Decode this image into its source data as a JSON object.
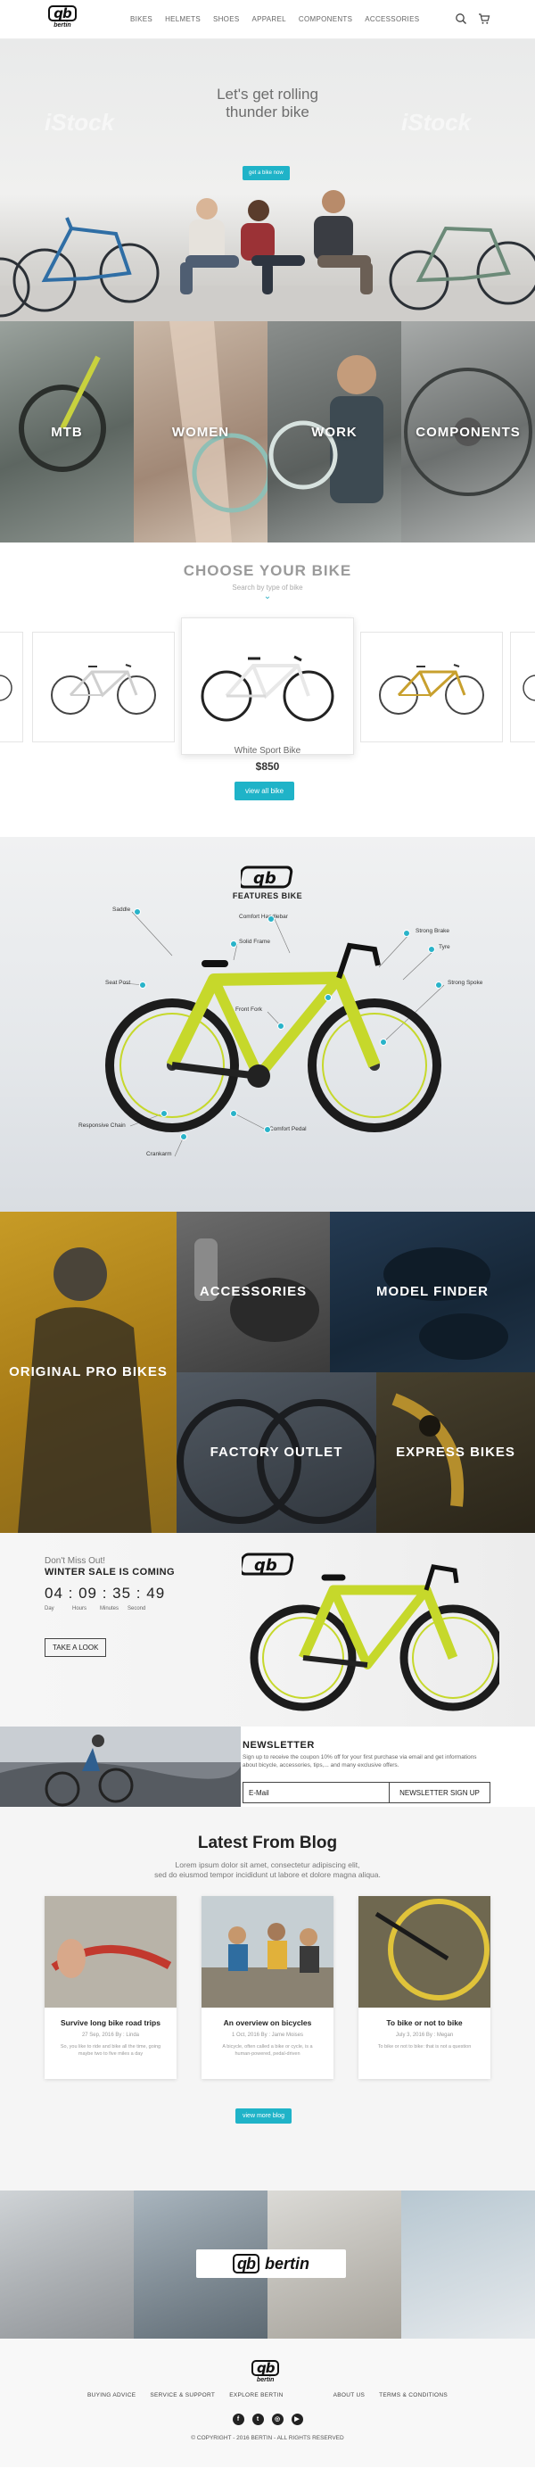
{
  "brand": {
    "logo_mark": "qb",
    "logo_word": "bertin"
  },
  "nav": [
    "BIKES",
    "HELMETS",
    "SHOES",
    "APPAREL",
    "COMPONENTS",
    "ACCESSORIES"
  ],
  "header_icons": [
    "search-icon",
    "cart-icon"
  ],
  "hero": {
    "title_line1": "Let's get rolling",
    "title_line2": "thunder bike",
    "button": "get a bike now",
    "watermark": "iStock"
  },
  "categories": [
    "MTB",
    "WOMEN",
    "WORK",
    "COMPONENTS"
  ],
  "choose": {
    "title": "CHOOSE YOUR BIKE",
    "subtitle": "Search by type of bike",
    "bike_name": "White Sport Bike",
    "bike_price": "$850",
    "button": "view all bike"
  },
  "features": {
    "logo": "qb",
    "title": "FEATURES BIKE",
    "labels": [
      "Saddle",
      "Comfort Handlebar",
      "Solid Frame",
      "Strong Brake",
      "Tyre",
      "Seat Post",
      "Strong Spoke",
      "Front Fork",
      "Responsive Chain",
      "Comfort Pedal",
      "Crankarm"
    ]
  },
  "promo": [
    "ORIGINAL PRO BIKES",
    "ACCESSORIES",
    "MODEL FINDER",
    "FACTORY OUTLET",
    "EXPRESS BIKES"
  ],
  "winter": {
    "pre": "Don't Miss Out!",
    "title": "WINTER SALE IS COMING",
    "countdown": "04 : 09 : 35 : 49",
    "units": [
      "Day",
      "Hours",
      "Minutes",
      "Second"
    ],
    "button": "TAKE A LOOK",
    "logo": "qb"
  },
  "newsletter": {
    "title": "NEWSLETTER",
    "text": "Sign up to receive the coupon 10% off for your first purchase via email and get informations about bicycle, accessories, tips,... and many exclusive offers.",
    "placeholder": "E-Mail",
    "button": "NEWSLETTER SIGN UP"
  },
  "blog": {
    "title": "Latest From Blog",
    "sub1": "Lorem ipsum dolor sit amet, consectetur adipiscing elit,",
    "sub2": "sed do eiusmod tempor incididunt ut labore et dolore magna aliqua.",
    "posts": [
      {
        "title": "Survive long bike road trips",
        "meta": "27 Sep, 2016 By : Linda",
        "excerpt": "So, you like to ride and bike all the time, going maybe two to five miles a day"
      },
      {
        "title": "An overview on bicycles",
        "meta": "1 Oct, 2016 By : Jame Moises",
        "excerpt": "A bicycle, often called a bike or cycle, is a human-powered, pedal-driven"
      },
      {
        "title": "To bike or not to bike",
        "meta": "July 3, 2016 By : Megan",
        "excerpt": "To bike or not to bike: that is not a question"
      }
    ],
    "button": "view more blog"
  },
  "footer_banner": {
    "logo_mark": "qb",
    "logo_word": "bertin"
  },
  "footer": {
    "logo_mark": "qb",
    "logo_word": "bertin",
    "links": [
      "BUYING ADVICE",
      "SERVICE & SUPPORT",
      "EXPLORE BERTIN",
      "ABOUT US",
      "TERMS & CONDITIONS"
    ],
    "social": [
      "facebook-icon",
      "twitter-icon",
      "instagram-icon",
      "youtube-icon"
    ],
    "copyright": "© COPYRIGHT - 2016 BERTIN - ALL RIGHTS RESERVED"
  },
  "colors": {
    "accent": "#1fb3c8",
    "lime": "#c6d82b",
    "mustard": "#c8a02e",
    "navy": "#1d3146"
  }
}
